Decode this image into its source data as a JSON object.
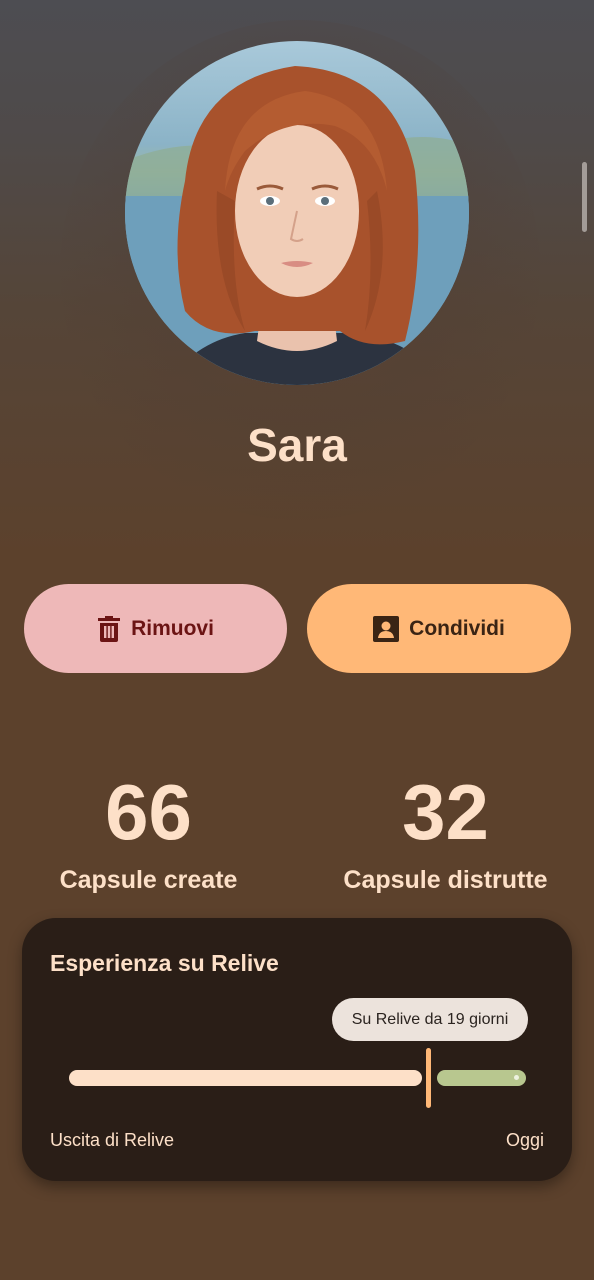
{
  "profile": {
    "name": "Sara"
  },
  "actions": {
    "remove_label": "Rimuovi",
    "remove_icon": "trash-icon",
    "share_label": "Condividi",
    "share_icon": "contact-card-icon"
  },
  "stats": [
    {
      "value": "66",
      "label": "Capsule create"
    },
    {
      "value": "32",
      "label": "Capsule distrutte"
    }
  ],
  "experience": {
    "title": "Esperienza su Relive",
    "tooltip": "Su Relive da 19 giorni",
    "start_label": "Uscita di Relive",
    "end_label": "Oggi",
    "progress": 0.8
  },
  "colors": {
    "background": "#5c412c",
    "text": "#fde0c8",
    "remove_button": "#eeb8b8",
    "share_button": "#ffb877",
    "card": "#2a1e17",
    "track_elapsed": "#fde0c8",
    "track_remaining": "#b8c78f",
    "thumb": "#ffb877"
  }
}
